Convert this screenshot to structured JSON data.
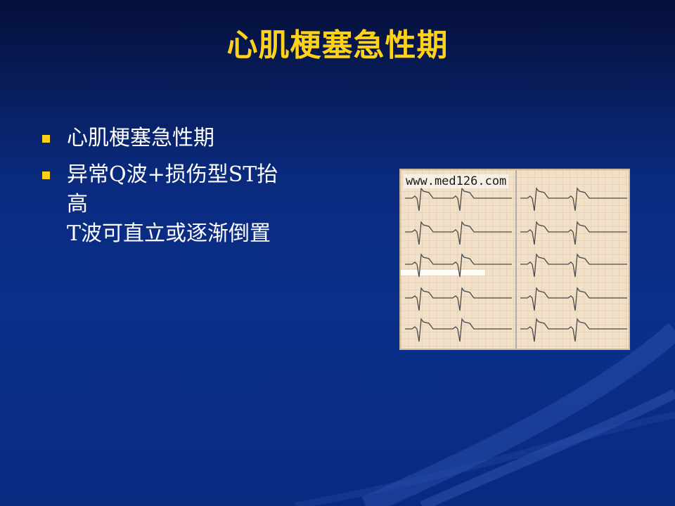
{
  "slide": {
    "title": "心肌梗塞急性期",
    "bullets": [
      {
        "lines": [
          "心肌梗塞急性期"
        ]
      },
      {
        "lines": [
          "异常Q波+损伤型ST抬",
          "高",
          "T波可直立或逐渐倒置"
        ]
      }
    ],
    "image": {
      "watermark": "www.med126.com",
      "icon": "ecg-tracing"
    }
  },
  "colors": {
    "title": "#ffd21a",
    "bullet_marker": "#ffd21a",
    "text": "#ffffff",
    "background": "#0b2f8a"
  }
}
